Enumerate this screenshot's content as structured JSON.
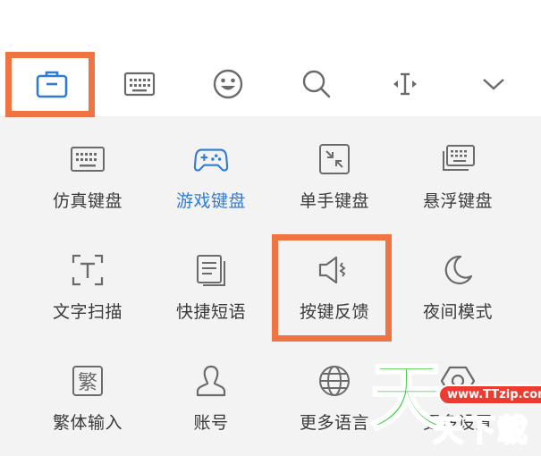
{
  "toolbar": {
    "items": [
      {
        "icon": "toolbox-icon",
        "active": true
      },
      {
        "icon": "keyboard-icon"
      },
      {
        "icon": "emoji-icon"
      },
      {
        "icon": "search-icon"
      },
      {
        "icon": "cursor-icon"
      },
      {
        "icon": "chevron-down-icon"
      }
    ]
  },
  "panel": {
    "items": [
      {
        "label": "仿真键盘",
        "icon": "keyboard-icon"
      },
      {
        "label": "游戏键盘",
        "icon": "gamepad-icon",
        "active": true
      },
      {
        "label": "单手键盘",
        "icon": "one-hand-icon"
      },
      {
        "label": "悬浮键盘",
        "icon": "floating-keyboard-icon"
      },
      {
        "label": "文字扫描",
        "icon": "text-scan-icon"
      },
      {
        "label": "快捷短语",
        "icon": "quick-phrase-icon"
      },
      {
        "label": "按键反馈",
        "icon": "speaker-icon"
      },
      {
        "label": "夜间模式",
        "icon": "moon-icon"
      },
      {
        "label": "繁体输入",
        "icon": "traditional-icon"
      },
      {
        "label": "账号",
        "icon": "user-icon"
      },
      {
        "label": "更多语言",
        "icon": "globe-icon"
      },
      {
        "label": "更多设置",
        "icon": "settings-icon"
      }
    ]
  },
  "watermark": {
    "big_char": "天",
    "url": "www.TTzip.com",
    "small_text": "天下載"
  },
  "colors": {
    "highlight": "#f07342",
    "active_blue": "#2f7bd6",
    "panel_bg": "#f3f3f4",
    "icon_gray": "#6b6b6b"
  }
}
